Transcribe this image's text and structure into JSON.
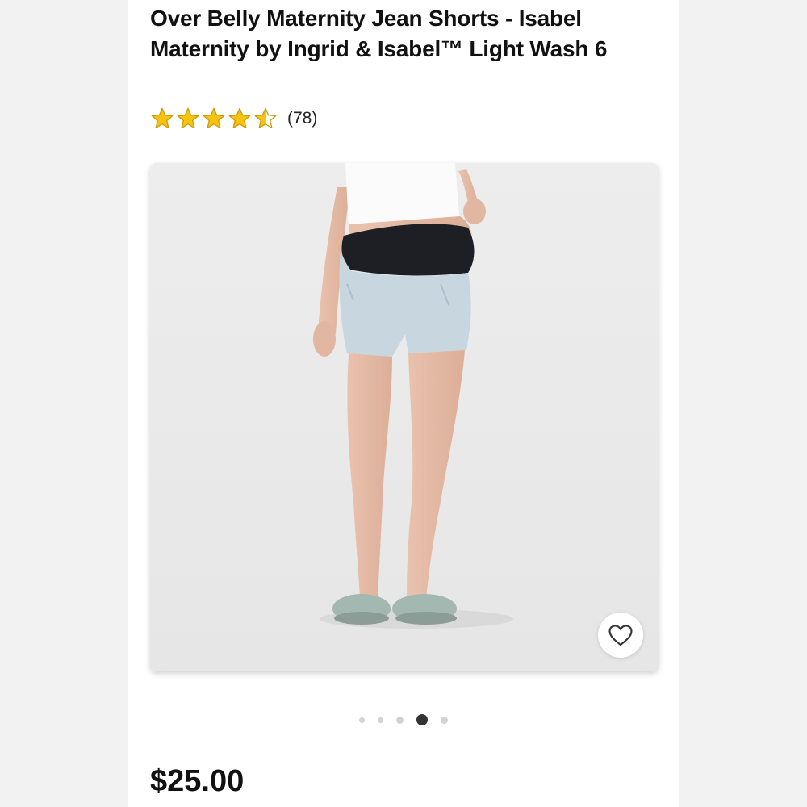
{
  "product": {
    "title": "Over Belly Maternity Jean Shorts - Isabel Maternity by Ingrid & Isabel™ Light Wash 6",
    "rating": 4.5,
    "review_count_label": "(78)",
    "price": "$25.00"
  },
  "gallery": {
    "image_count": 5,
    "active_index": 3
  },
  "icons": {
    "favorite": "heart-outline-icon",
    "star": "star-icon"
  },
  "colors": {
    "star": "#f6c40f",
    "active_dot": "#333333",
    "inactive_dot": "#d3d3d3"
  }
}
